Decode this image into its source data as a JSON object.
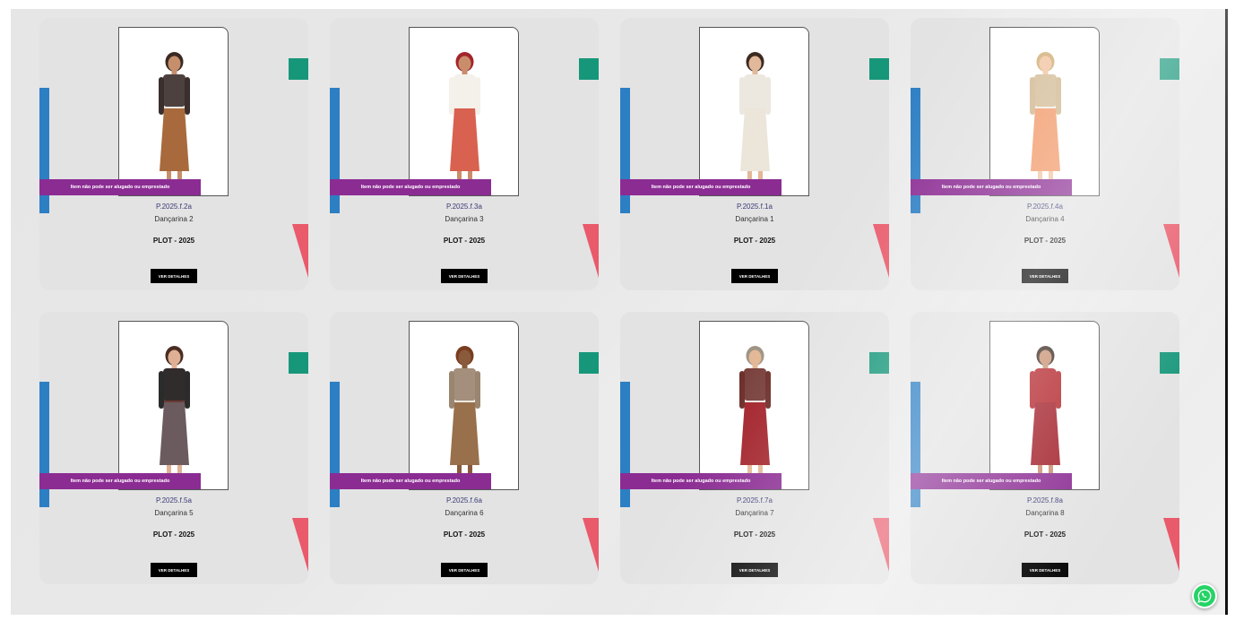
{
  "products": [
    {
      "code": "P.2025.f.2a",
      "name": "Dançarina 2",
      "event": "PLOT - 2025",
      "banner": "Item não pode ser alugado ou emprestado",
      "button": "VER DETALHES",
      "hair": "#3a2a22",
      "top": "#efe9e4",
      "jacket": "#3b2f2d",
      "bottom": "#a86a3c",
      "skin": "#c68f6c",
      "shoes": "#6b4a34"
    },
    {
      "code": "P.2025.f.3a",
      "name": "Dançarina 3",
      "event": "PLOT - 2025",
      "banner": "Item não pode ser alugado ou emprestado",
      "button": "VER DETALHES",
      "hair": "#a3242b",
      "top": "#f4f0ea",
      "jacket": "",
      "bottom": "#d8614f",
      "skin": "#c98d6c",
      "shoes": "#e5d3c2"
    },
    {
      "code": "P.2025.f.1a",
      "name": "Dançarina 1",
      "event": "PLOT - 2025",
      "banner": "Item não pode ser alugado ou emprestado",
      "button": "VER DETALHES",
      "hair": "#3b2a20",
      "top": "#ece7df",
      "jacket": "",
      "bottom": "#ebe5da",
      "skin": "#e2b89a",
      "shoes": "#e8e8e8"
    },
    {
      "code": "P.2025.f.4a",
      "name": "Dançarina 4",
      "event": "PLOT - 2025",
      "banner": "Item não pode ser alugado ou emprestado",
      "button": "VER DETALHES",
      "hair": "#d2b07a",
      "top": "#f3eee7",
      "jacket": "#d2b891",
      "bottom": "#f29a6a",
      "skin": "#f1c6a4",
      "shoes": "#d9c7b0"
    },
    {
      "code": "P.2025.f.5a",
      "name": "Dançarina 5",
      "event": "PLOT - 2025",
      "banner": "Item não pode ser alugado ou emprestado",
      "button": "VER DETALHES",
      "hair": "#4a2c22",
      "top": "#6a3a34",
      "jacket": "#2b2b2b",
      "bottom": "#6b5b5e",
      "skin": "#e0b094",
      "shoes": "#222222"
    },
    {
      "code": "P.2025.f.6a",
      "name": "Dançarina 6",
      "event": "PLOT - 2025",
      "banner": "Item não pode ser alugado ou emprestado",
      "button": "VER DETALHES",
      "hair": "#7a3d20",
      "top": "#efe9e1",
      "jacket": "#9a8570",
      "bottom": "#98704b",
      "skin": "#8a5a3c",
      "shoes": "#e9e9e9"
    },
    {
      "code": "P.2025.f.7a",
      "name": "Dançarina 7",
      "event": "PLOT - 2025",
      "banner": "Item não pode ser alugado ou emprestado",
      "button": "VER DETALHES",
      "hair": "#9e9585",
      "top": "#eceae6",
      "jacket": "#6d2f2a",
      "bottom": "#a3232b",
      "skin": "#e3b896",
      "shoes": "#1f1f1f"
    },
    {
      "code": "P.2025.f.8a",
      "name": "Dançarina 8",
      "event": "PLOT - 2025",
      "banner": "Item não pode ser alugado ou emprestado",
      "button": "VER DETALHES",
      "hair": "#3a2a22",
      "top": "#b3262c",
      "jacket": "",
      "bottom": "#a3212b",
      "skin": "#c89072",
      "shoes": "#1f1f1f"
    }
  ],
  "accent_colors": {
    "blue": "#2d7fc4",
    "green": "#17977a",
    "pink": "#e95a6b",
    "banner": "#8b2c93",
    "button": "#000000"
  },
  "floating": {
    "icon": "whatsapp-icon"
  }
}
